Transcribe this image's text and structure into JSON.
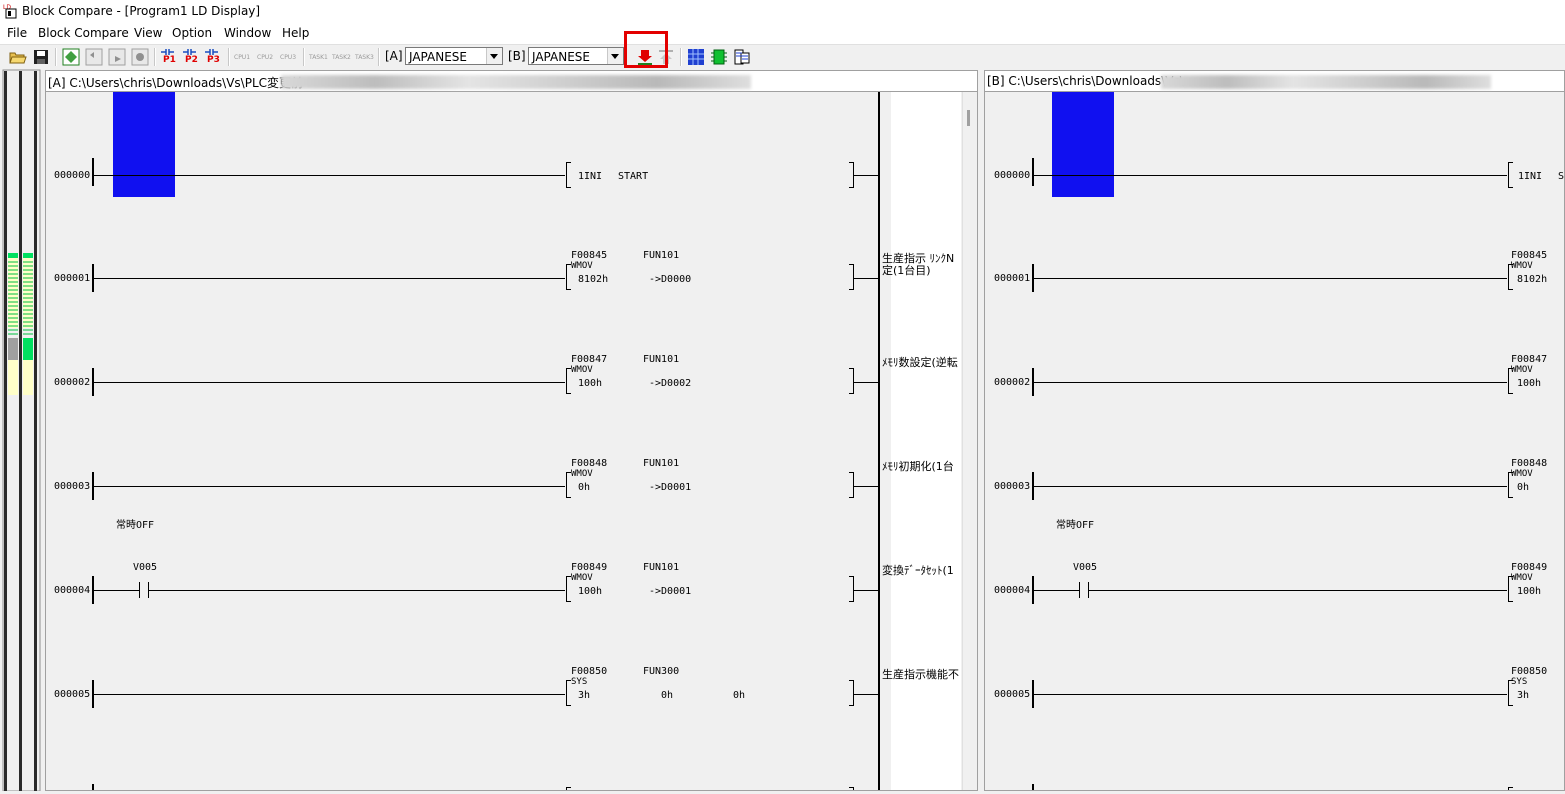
{
  "window": {
    "title": "Block Compare -  [Program1 LD  Display]"
  },
  "menu": [
    "File",
    "Block Compare",
    "View",
    "Option",
    "Window",
    "Help"
  ],
  "toolbar": {
    "p_buttons": [
      "P1",
      "P2",
      "P3"
    ],
    "cpu_buttons": [
      "CPU1",
      "CPU2",
      "CPU3"
    ],
    "task_buttons": [
      "TASK1",
      "TASK2",
      "TASK3"
    ],
    "label_a": "[A]",
    "label_b": "[B]",
    "lang_a": "JAPANESE",
    "lang_b": "JAPANESE"
  },
  "colors": {
    "highlight": "#e30000",
    "block": "#1010f0",
    "diff_green": "#00e060"
  },
  "pane_a": {
    "path": "[A] C:\\Users\\chris\\Downloads\\Vs\\PLC変更前"
  },
  "pane_b": {
    "path": "[B] C:\\Users\\chris\\Downloads\\Vs\\"
  },
  "rungs": [
    {
      "num": "000000",
      "f": "",
      "fn": "",
      "op": "1INI",
      "arg1": "START",
      "arg2": "",
      "arg3": "",
      "comment": "",
      "comment2": "",
      "contact": "",
      "above": ""
    },
    {
      "num": "000001",
      "f": "F00845",
      "fn": "FUN101",
      "op": "WMOV",
      "arg1": "8102h",
      "arg2": "->D0000",
      "arg3": "",
      "comment": "生産指示 ﾘﾝｸN",
      "comment2": "定(1台目)",
      "contact": "",
      "above": ""
    },
    {
      "num": "000002",
      "f": "F00847",
      "fn": "FUN101",
      "op": "WMOV",
      "arg1": "100h",
      "arg2": "->D0002",
      "arg3": "",
      "comment": "ﾒﾓﾘ数設定(逆転",
      "comment2": "",
      "contact": "",
      "above": ""
    },
    {
      "num": "000003",
      "f": "F00848",
      "fn": "FUN101",
      "op": "WMOV",
      "arg1": "0h",
      "arg2": "->D0001",
      "arg3": "",
      "comment": "ﾒﾓﾘ初期化(1台",
      "comment2": "",
      "contact": "",
      "above": ""
    },
    {
      "num": "000004",
      "f": "F00849",
      "fn": "FUN101",
      "op": "WMOV",
      "arg1": "100h",
      "arg2": "->D0001",
      "arg3": "",
      "comment": "変換ﾃﾞｰﾀｾｯﾄ(1",
      "comment2": "",
      "contact": "V005",
      "above": "常時OFF"
    },
    {
      "num": "000005",
      "f": "F00850",
      "fn": "FUN300",
      "op": "SYS",
      "arg1": "3h",
      "arg2": "0h",
      "arg3": "0h",
      "comment": "生産指示機能不",
      "comment2": "",
      "contact": "",
      "above": ""
    }
  ]
}
